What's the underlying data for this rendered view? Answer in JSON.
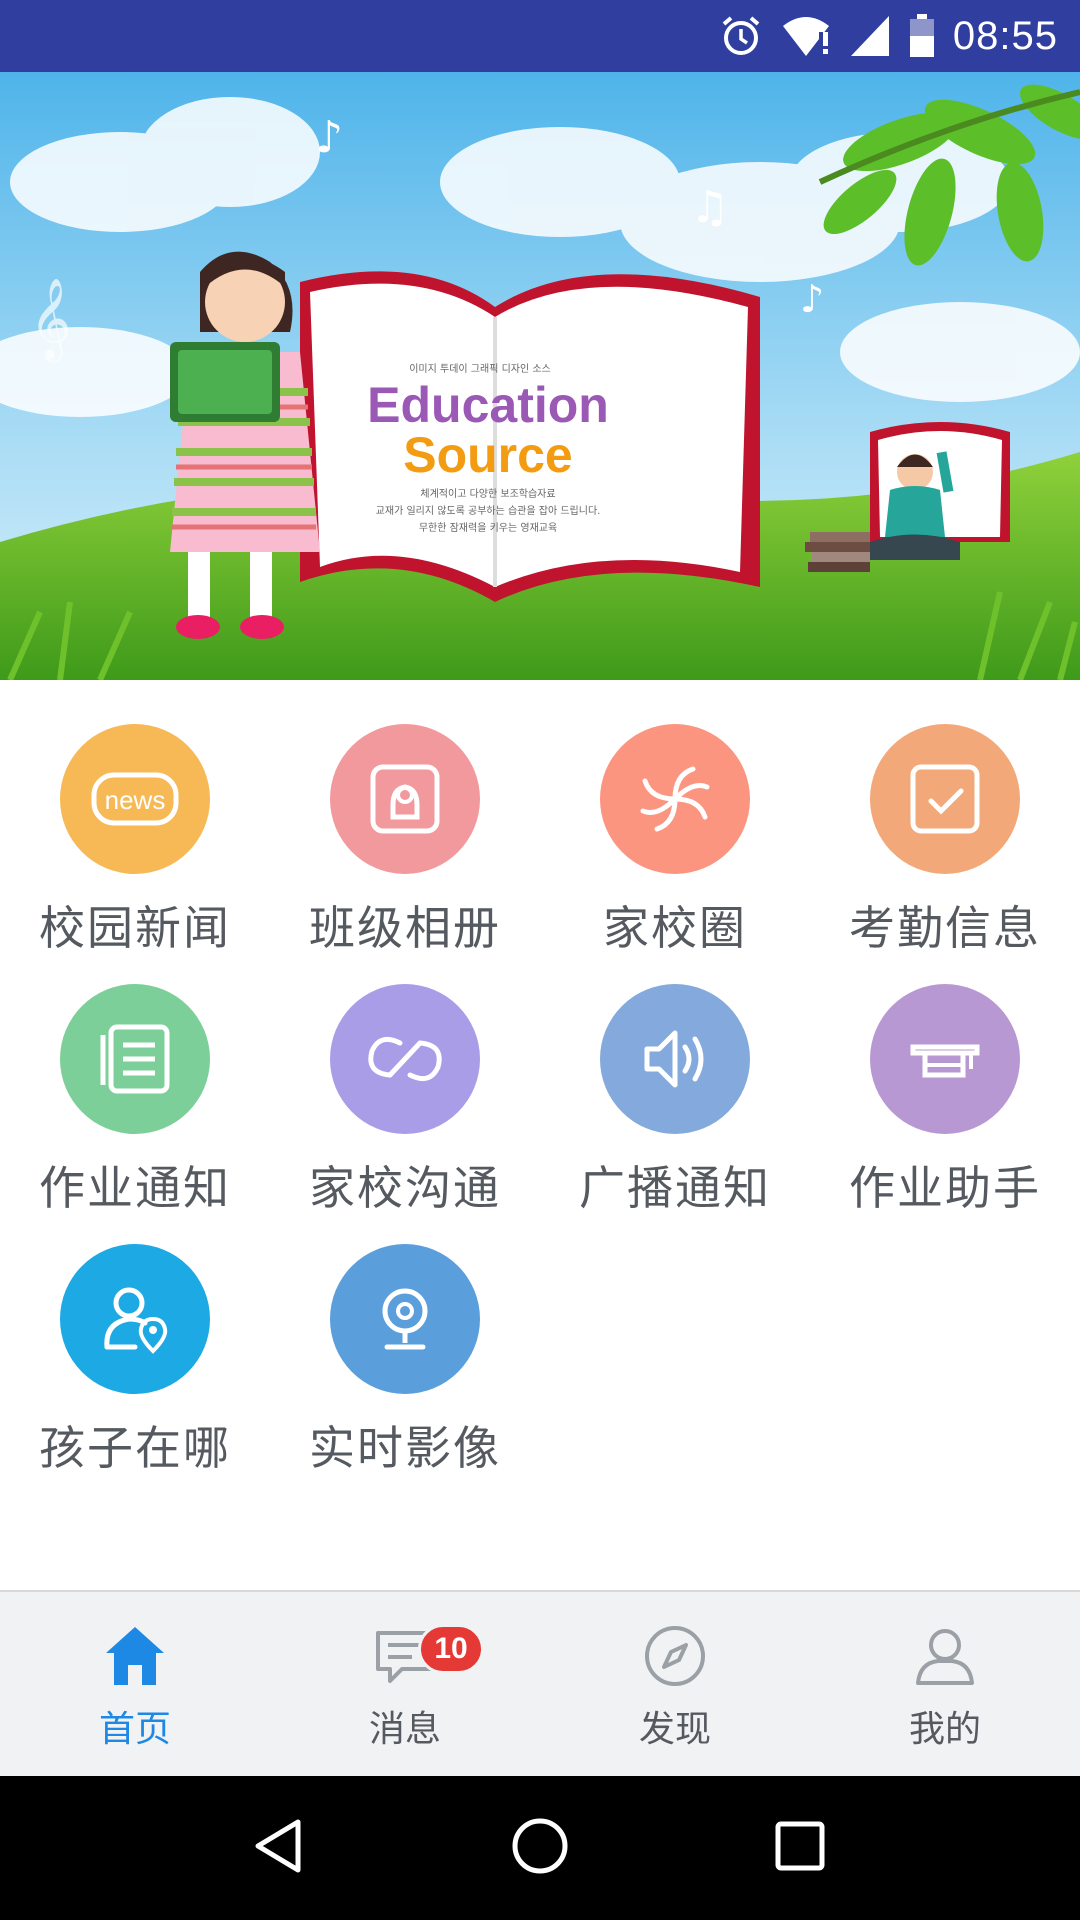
{
  "status_bar": {
    "time": "08:55",
    "icons": [
      "alarm-icon",
      "wifi-icon",
      "signal-icon",
      "battery-icon"
    ]
  },
  "banner": {
    "title_line1": "Education",
    "title_line2": "Source",
    "korean_top": "이미지 투데이 그래픽 디자인 소스",
    "korean_line1": "체계적이고 다양한 보조학습자료",
    "korean_line2": "교재가 일리지 않도록 공부하는 습관을 잡아 드립니다.",
    "korean_line3": "무한한 잠재력을 키우는 영재교육"
  },
  "grid": {
    "items": [
      {
        "label": "校园新闻",
        "icon": "news-icon",
        "color": "#f6b955"
      },
      {
        "label": "班级相册",
        "icon": "album-icon",
        "color": "#f2999d"
      },
      {
        "label": "家校圈",
        "icon": "aperture-icon",
        "color": "#fc9580"
      },
      {
        "label": "考勤信息",
        "icon": "attendance-icon",
        "color": "#f2a878"
      },
      {
        "label": "作业通知",
        "icon": "homework-icon",
        "color": "#7ccf98"
      },
      {
        "label": "家校沟通",
        "icon": "link-icon",
        "color": "#a99de8"
      },
      {
        "label": "广播通知",
        "icon": "speaker-icon",
        "color": "#84a9dc"
      },
      {
        "label": "作业助手",
        "icon": "graduation-cap-icon",
        "color": "#b898d2"
      },
      {
        "label": "孩子在哪",
        "icon": "child-location-icon",
        "color": "#1da9e4"
      },
      {
        "label": "实时影像",
        "icon": "webcam-icon",
        "color": "#5a9edc"
      }
    ]
  },
  "bottom_nav": {
    "items": [
      {
        "label": "首页",
        "icon": "home-icon",
        "active": true
      },
      {
        "label": "消息",
        "icon": "message-icon",
        "badge": "10"
      },
      {
        "label": "发现",
        "icon": "compass-icon"
      },
      {
        "label": "我的",
        "icon": "profile-icon"
      }
    ]
  },
  "colors": {
    "status_bar": "#303f9f",
    "active_nav": "#1e88e5",
    "badge": "#e53935"
  }
}
